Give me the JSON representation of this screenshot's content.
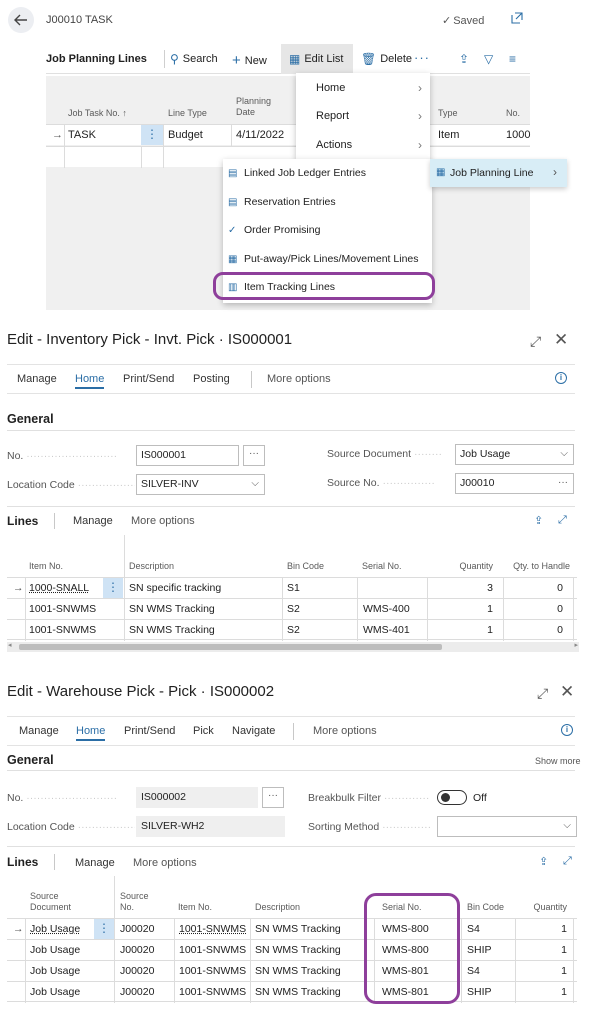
{
  "card": {
    "title": "J00010 TASK",
    "saved": "Saved",
    "toolbar": {
      "tab": "Job Planning Lines",
      "search": "Search",
      "new": "New",
      "edit_list": "Edit List",
      "delete": "Delete"
    },
    "columns": [
      "Job Task No. ↑",
      "Line Type",
      "Planning Date",
      "Type",
      "No."
    ],
    "row": {
      "job_task_no": "TASK",
      "line_type": "Budget",
      "planning_date": "4/11/2022",
      "type": "Item",
      "no": "1000"
    },
    "menu": [
      "Home",
      "Report",
      "Actions"
    ],
    "submenu": [
      "Linked Job Ledger Entries",
      "Reservation Entries",
      "Order Promising",
      "Put-away/Pick Lines/Movement Lines",
      "Item Tracking Lines"
    ],
    "flyout": "Job Planning Line"
  },
  "invt_pick": {
    "title": "Edit - Inventory Pick - Invt. Pick · IS000001",
    "nav": [
      "Manage",
      "Home",
      "Print/Send",
      "Posting",
      "More options"
    ],
    "general": "General",
    "fields": {
      "no_label": "No.",
      "no_value": "IS000001",
      "location_label": "Location Code",
      "location_value": "SILVER-INV",
      "source_doc_label": "Source Document",
      "source_doc_value": "Job Usage",
      "source_no_label": "Source No.",
      "source_no_value": "J00010"
    },
    "lines": {
      "title": "Lines",
      "manage": "Manage",
      "more": "More options"
    },
    "columns": [
      "Item No.",
      "Description",
      "Bin Code",
      "Serial No.",
      "Quantity",
      "Qty. to Handle"
    ],
    "rows": [
      {
        "item_no": "1000-SNALL",
        "description": "SN specific tracking",
        "bin": "S1",
        "serial": "",
        "qty": "3",
        "to_handle": "0"
      },
      {
        "item_no": "1001-SNWMS",
        "description": "SN WMS Tracking",
        "bin": "S2",
        "serial": "WMS-400",
        "qty": "1",
        "to_handle": "0"
      },
      {
        "item_no": "1001-SNWMS",
        "description": "SN WMS Tracking",
        "bin": "S2",
        "serial": "WMS-401",
        "qty": "1",
        "to_handle": "0"
      }
    ]
  },
  "wh_pick": {
    "title": "Edit - Warehouse Pick - Pick · IS000002",
    "nav": [
      "Manage",
      "Home",
      "Print/Send",
      "Pick",
      "Navigate",
      "More options"
    ],
    "general": "General",
    "show_more": "Show more",
    "fields": {
      "no_label": "No.",
      "no_value": "IS000002",
      "location_label": "Location Code",
      "location_value": "SILVER-WH2",
      "breakbulk_label": "Breakbulk Filter",
      "breakbulk_value": "Off",
      "sorting_label": "Sorting Method",
      "sorting_value": ""
    },
    "lines": {
      "title": "Lines",
      "manage": "Manage",
      "more": "More options"
    },
    "columns": [
      "Source Document",
      "Source No.",
      "Item No.",
      "Description",
      "Serial No.",
      "Bin Code",
      "Quantity"
    ],
    "rows": [
      {
        "source_doc": "Job Usage",
        "source_no": "J00020",
        "item_no": "1001-SNWMS",
        "description": "SN WMS Tracking",
        "serial": "WMS-800",
        "bin": "S4",
        "qty": "1"
      },
      {
        "source_doc": "Job Usage",
        "source_no": "J00020",
        "item_no": "1001-SNWMS",
        "description": "SN WMS Tracking",
        "serial": "WMS-800",
        "bin": "SHIP",
        "qty": "1"
      },
      {
        "source_doc": "Job Usage",
        "source_no": "J00020",
        "item_no": "1001-SNWMS",
        "description": "SN WMS Tracking",
        "serial": "WMS-801",
        "bin": "S4",
        "qty": "1"
      },
      {
        "source_doc": "Job Usage",
        "source_no": "J00020",
        "item_no": "1001-SNWMS",
        "description": "SN WMS Tracking",
        "serial": "WMS-801",
        "bin": "SHIP",
        "qty": "1"
      }
    ]
  },
  "colors": {
    "accent": "#2b6ea6",
    "highlight": "#8e3f9b",
    "selected": "#cfe3f5"
  }
}
